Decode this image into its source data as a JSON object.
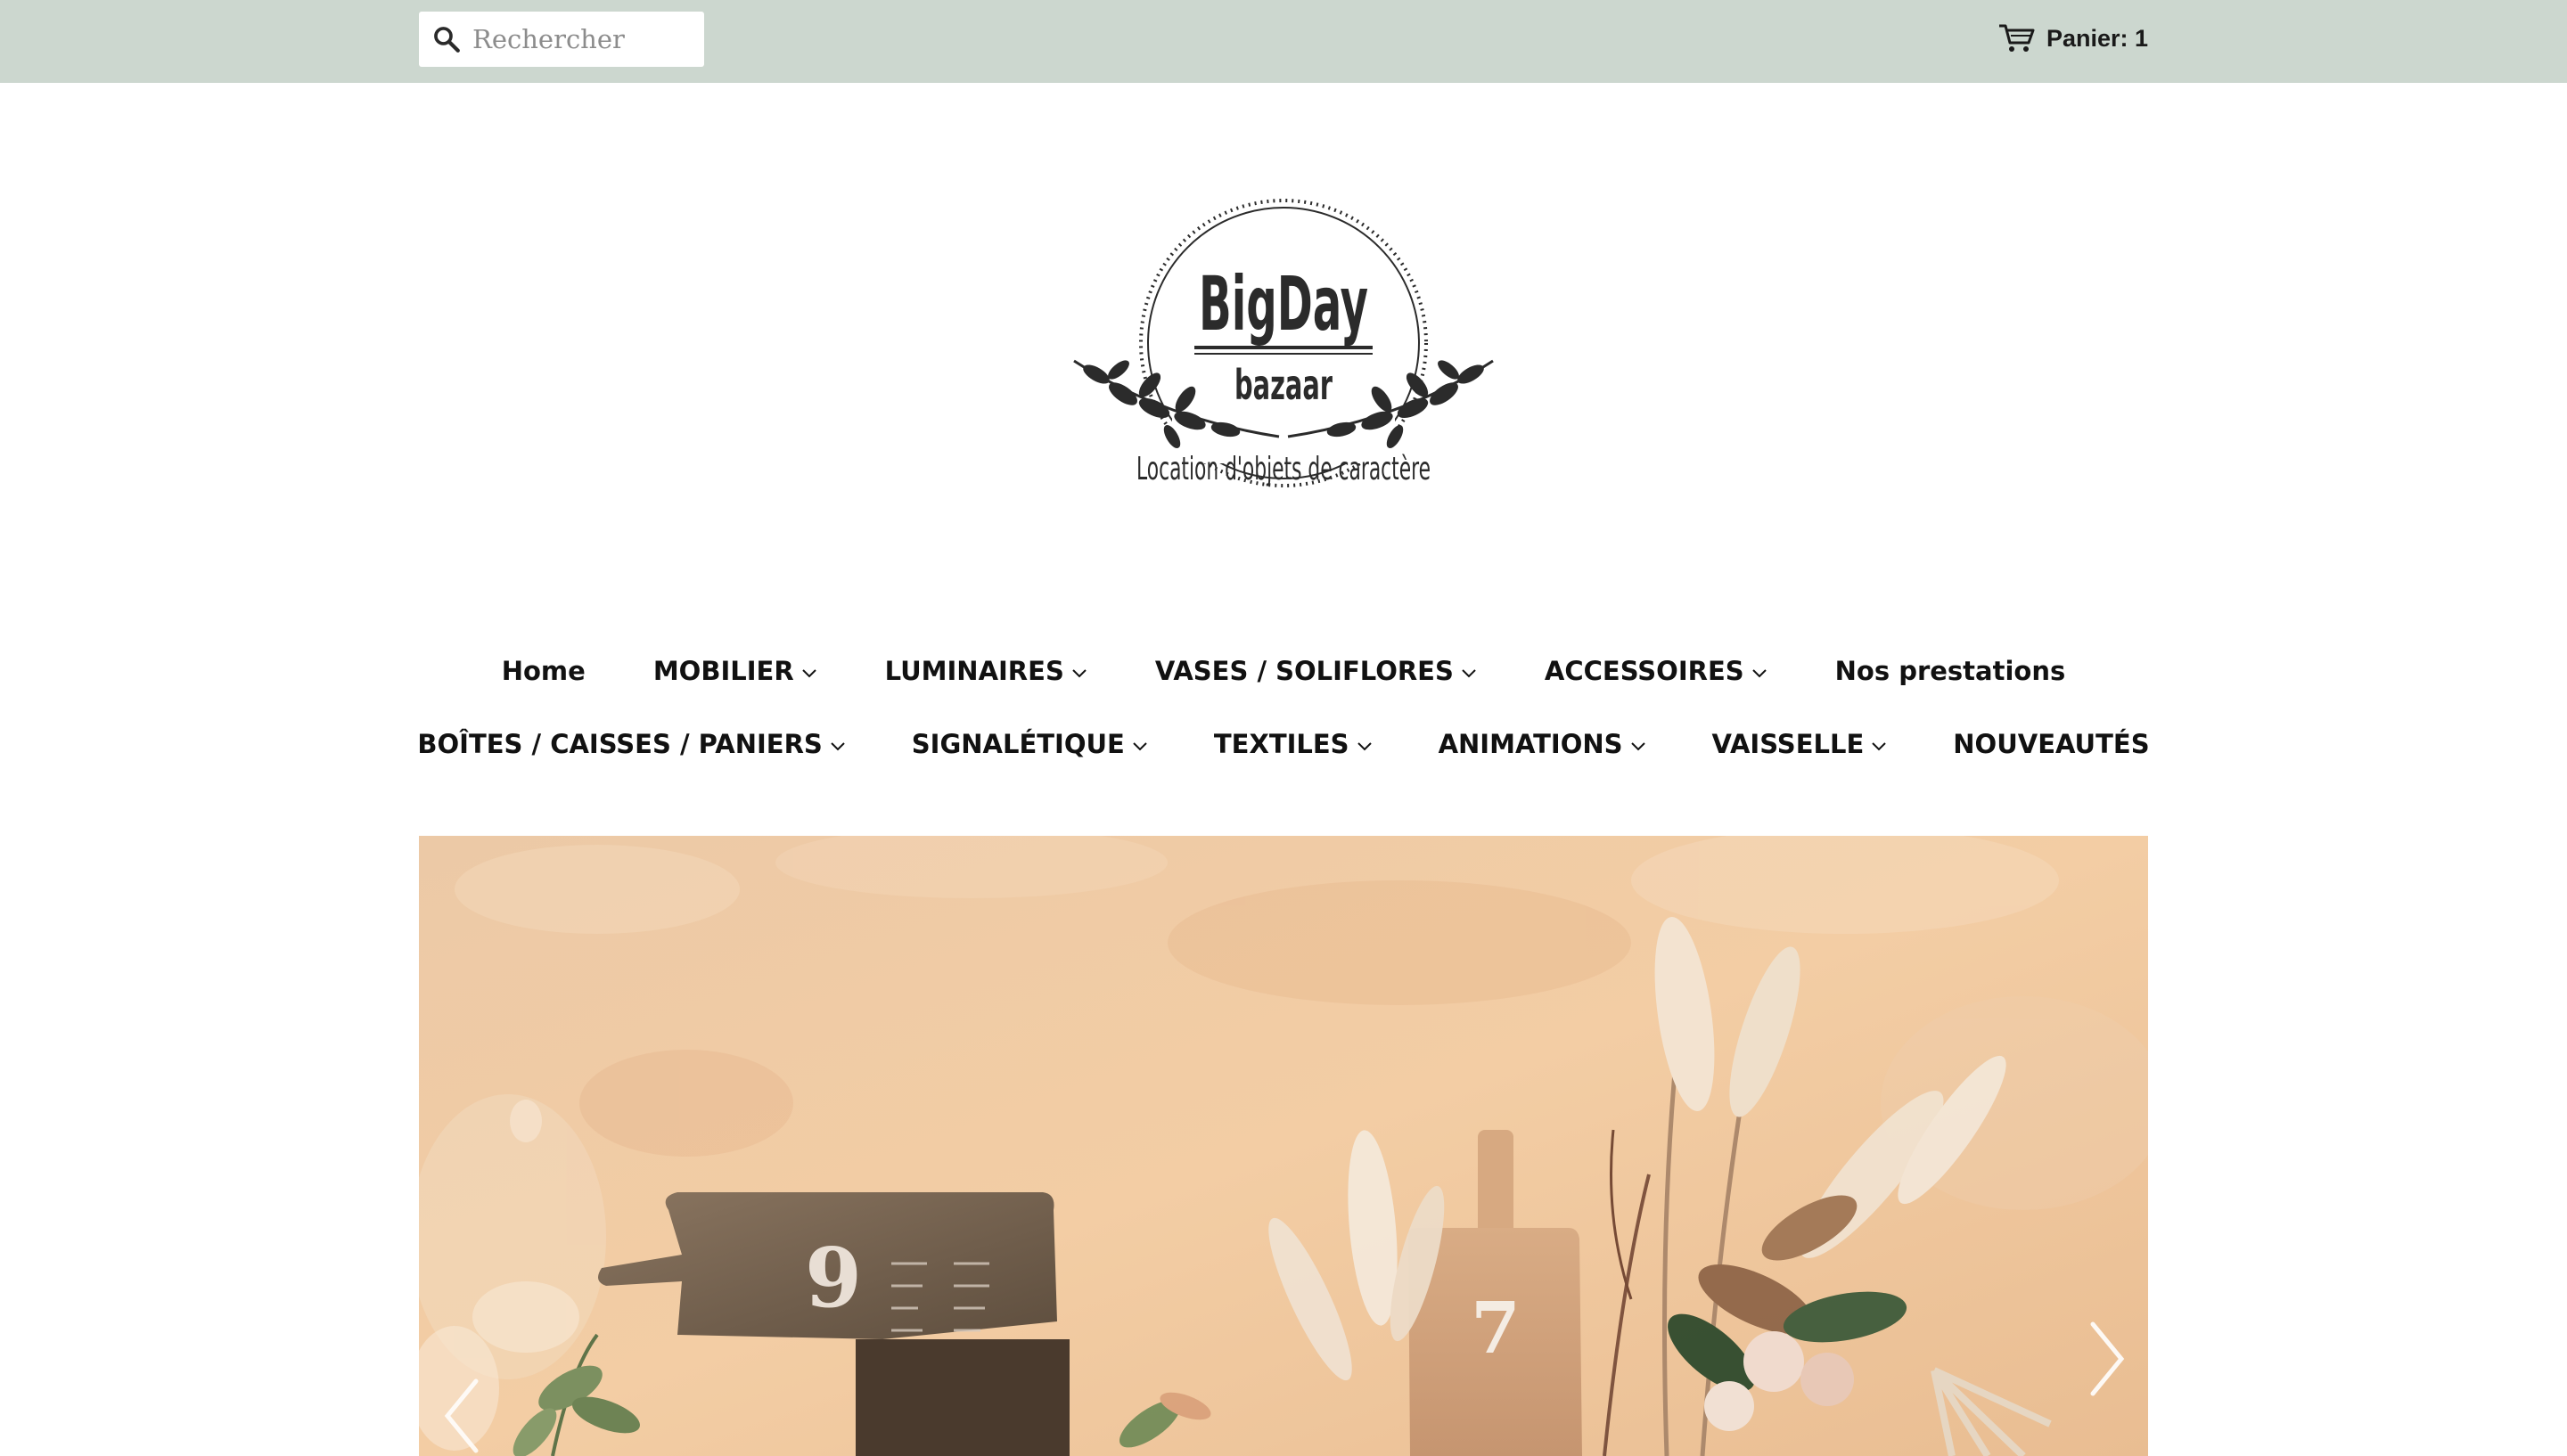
{
  "header": {
    "search_placeholder": "Rechercher",
    "cart_label": "Panier: 1"
  },
  "logo": {
    "line1": "BigDay",
    "line2": "bazaar",
    "tagline": "Location d'objets de caractère"
  },
  "nav": {
    "row1": [
      {
        "label": "Home",
        "dropdown": false
      },
      {
        "label": "MOBILIER",
        "dropdown": true
      },
      {
        "label": "LUMINAIRES",
        "dropdown": true
      },
      {
        "label": "VASES / SOLIFLORES",
        "dropdown": true
      },
      {
        "label": "ACCESSOIRES",
        "dropdown": true
      },
      {
        "label": "Nos prestations",
        "dropdown": false
      }
    ],
    "row2": [
      {
        "label": "BOÎTES / CAISSES / PANIERS",
        "dropdown": true
      },
      {
        "label": "SIGNALÉTIQUE",
        "dropdown": true
      },
      {
        "label": "TEXTILES",
        "dropdown": true
      },
      {
        "label": "ANIMATIONS",
        "dropdown": true
      },
      {
        "label": "VAISSELLE",
        "dropdown": true
      },
      {
        "label": "NOUVEAUTÉS",
        "dropdown": false
      }
    ]
  },
  "hero": {
    "board_left_number": "9",
    "board_right_number": "7"
  },
  "colors": {
    "topbar": "#ccd7cf",
    "wall": "#f0c9a3",
    "text": "#111111"
  }
}
